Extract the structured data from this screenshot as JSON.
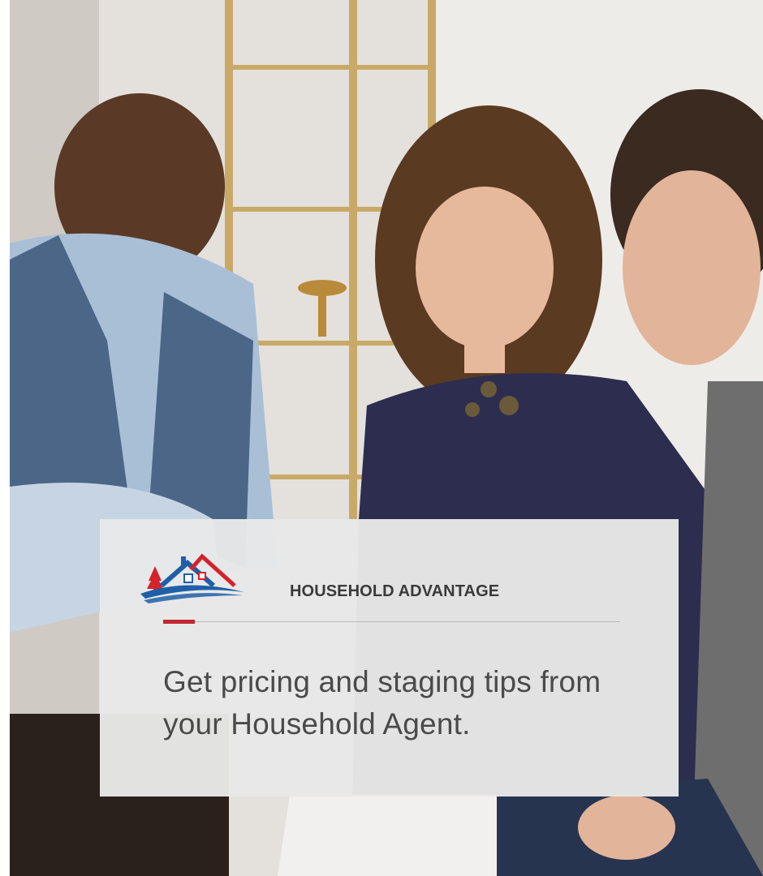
{
  "brand": {
    "name": "HOUSEHOLD ADVANTAGE",
    "logo_icon": "house-roof-logo-icon",
    "accent_color": "#c1272d",
    "logo_blue": "#1f5fa8",
    "logo_red": "#d4232b"
  },
  "promo": {
    "headline": "Get pricing and staging tips from your Household Agent."
  },
  "hero_image": "photo-three-people-reviewing-tablet"
}
